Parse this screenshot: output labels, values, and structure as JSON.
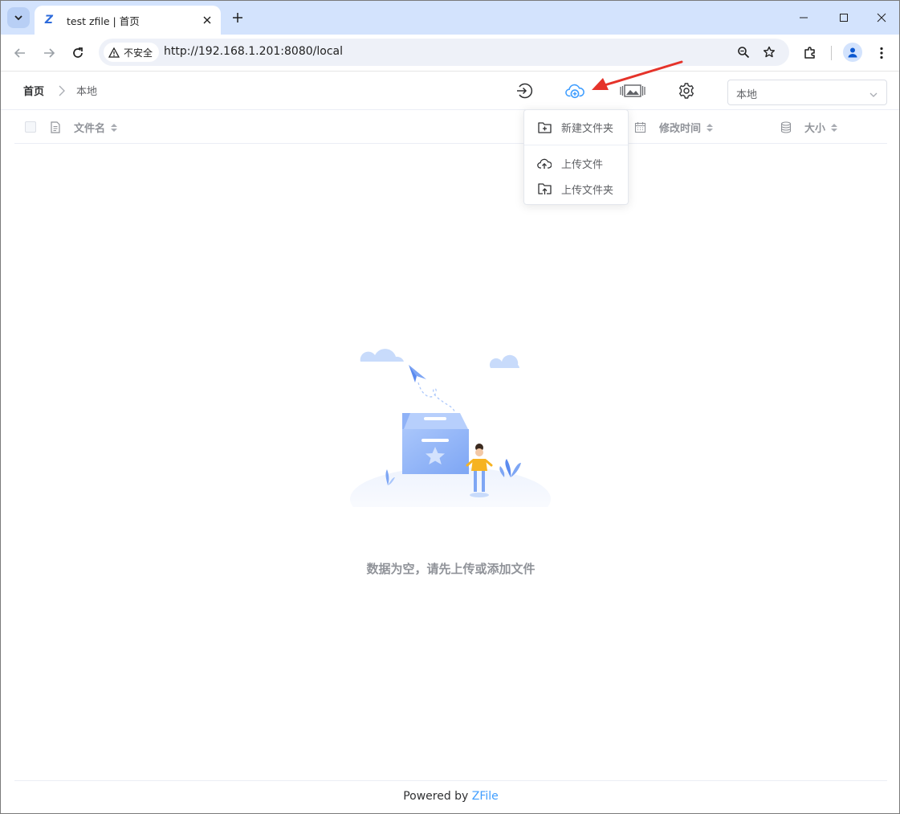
{
  "browser": {
    "tab_title": "test zfile | 首页",
    "tab_favicon": "Z",
    "security_label": "不安全",
    "url": "http://192.168.1.201:8080/local",
    "icons": {
      "tab_search": "chevron-down-icon",
      "tab_close": "close-icon",
      "new_tab": "plus-icon",
      "back": "arrow-left-icon",
      "forward": "arrow-right-icon",
      "reload": "reload-icon",
      "zoom": "zoom-icon",
      "bookmark": "star-icon",
      "extensions": "puzzle-icon",
      "profile": "person-icon",
      "menu": "kebab-icon"
    }
  },
  "breadcrumb": {
    "home": "首页",
    "current": "本地"
  },
  "header": {
    "storage_select_value": "本地",
    "accent_color": "#409eff"
  },
  "table": {
    "columns": {
      "name": "文件名",
      "modified": "修改时间",
      "size": "大小"
    }
  },
  "dropdown": {
    "items": [
      {
        "label": "新建文件夹",
        "icon": "folder-plus-icon"
      },
      {
        "label": "上传文件",
        "icon": "cloud-upload-icon"
      },
      {
        "label": "上传文件夹",
        "icon": "folder-upload-icon"
      }
    ]
  },
  "empty": {
    "message": "数据为空，请先上传或添加文件"
  },
  "footer": {
    "prefix": "Powered by ",
    "brand": "ZFile"
  }
}
